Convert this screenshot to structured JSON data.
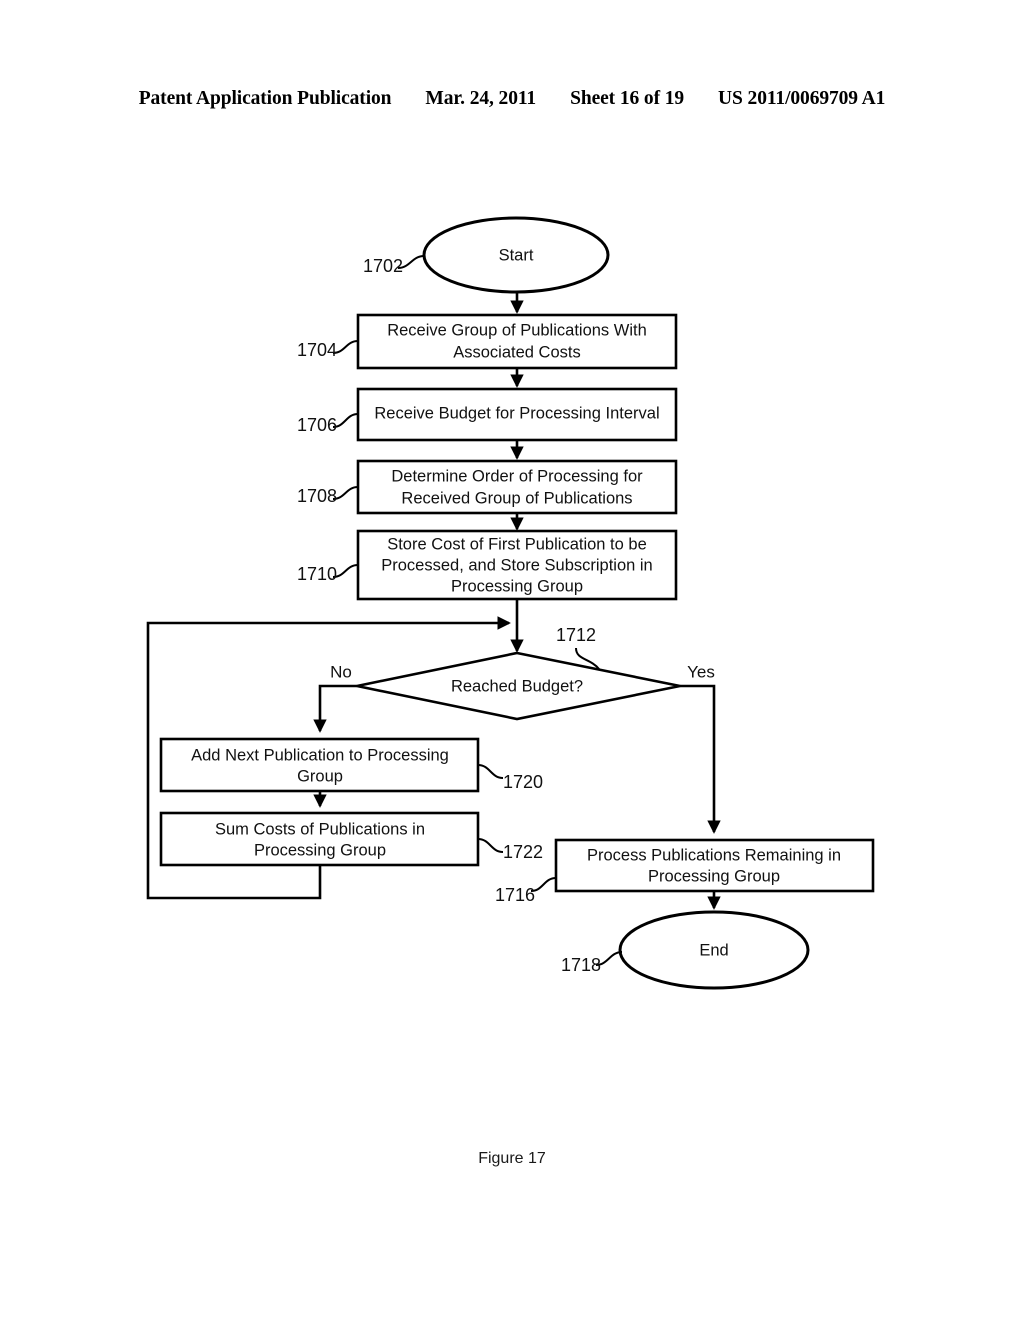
{
  "header": {
    "publication": "Patent Application Publication",
    "date": "Mar. 24, 2011",
    "sheet": "Sheet 16 of 19",
    "number": "US 2011/0069709 A1"
  },
  "figure": {
    "caption": "Figure 17"
  },
  "flowchart": {
    "branch_labels": {
      "no": "No",
      "yes": "Yes"
    },
    "nodes": [
      {
        "id": "start",
        "ref": "1702",
        "type": "terminator",
        "lines": [
          "Start"
        ]
      },
      {
        "id": "receive_group",
        "ref": "1704",
        "type": "process",
        "lines": [
          "Receive Group of Publications With",
          "Associated Costs"
        ]
      },
      {
        "id": "receive_budget",
        "ref": "1706",
        "type": "process",
        "lines": [
          "Receive Budget for Processing Interval"
        ]
      },
      {
        "id": "determine_order",
        "ref": "1708",
        "type": "process",
        "lines": [
          "Determine Order of Processing for",
          "Received Group of Publications"
        ]
      },
      {
        "id": "store_cost",
        "ref": "1710",
        "type": "process",
        "lines": [
          "Store Cost of First Publication to be",
          "Processed, and Store Subscription in",
          "Processing Group"
        ]
      },
      {
        "id": "reached_budget",
        "ref": "1712",
        "type": "decision",
        "lines": [
          "Reached Budget?"
        ]
      },
      {
        "id": "add_next",
        "ref": "1720",
        "type": "process",
        "lines": [
          "Add Next Publication to Processing",
          "Group"
        ]
      },
      {
        "id": "sum_costs",
        "ref": "1722",
        "type": "process",
        "lines": [
          "Sum Costs of Publications in",
          "Processing Group"
        ]
      },
      {
        "id": "process_remaining",
        "ref": "1716",
        "type": "process",
        "lines": [
          "Process Publications Remaining in",
          "Processing Group"
        ]
      },
      {
        "id": "end",
        "ref": "1718",
        "type": "terminator",
        "lines": [
          "End"
        ]
      }
    ]
  },
  "colors": {
    "ink": "#000000",
    "paper": "#ffffff"
  }
}
